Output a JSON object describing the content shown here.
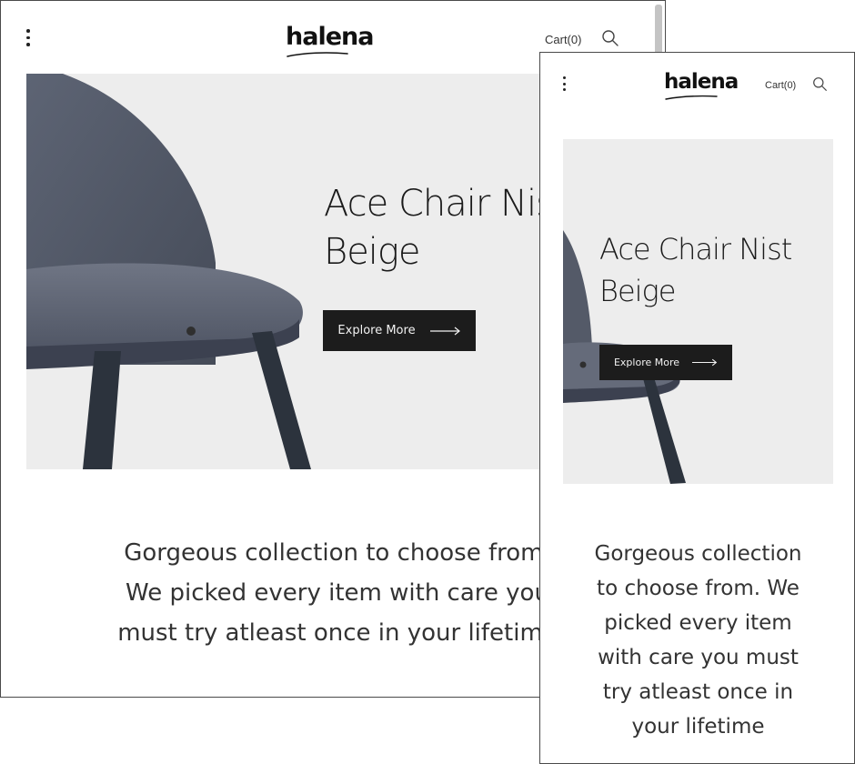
{
  "brand": {
    "logo_text": "halena"
  },
  "header": {
    "menu_icon": "kebab-menu-icon",
    "cart_label": "Cart(0)",
    "search_icon": "search-icon"
  },
  "hero": {
    "title_line1": "Ace Chair Nist",
    "title_line2": "Beige",
    "cta_label": "Explore More",
    "cta_icon": "long-arrow-right-icon",
    "background": "#ededed",
    "button_color": "#1c1c1c"
  },
  "description": {
    "tablet_lines": [
      "Gorgeous collection to choose from.",
      "We picked every item with care you",
      "must try atleast once in your lifetime"
    ],
    "mobile_lines": [
      "Gorgeous collection",
      "to choose from. We",
      "picked every item",
      "with care you must",
      "try atleast once in",
      "your lifetime"
    ]
  }
}
